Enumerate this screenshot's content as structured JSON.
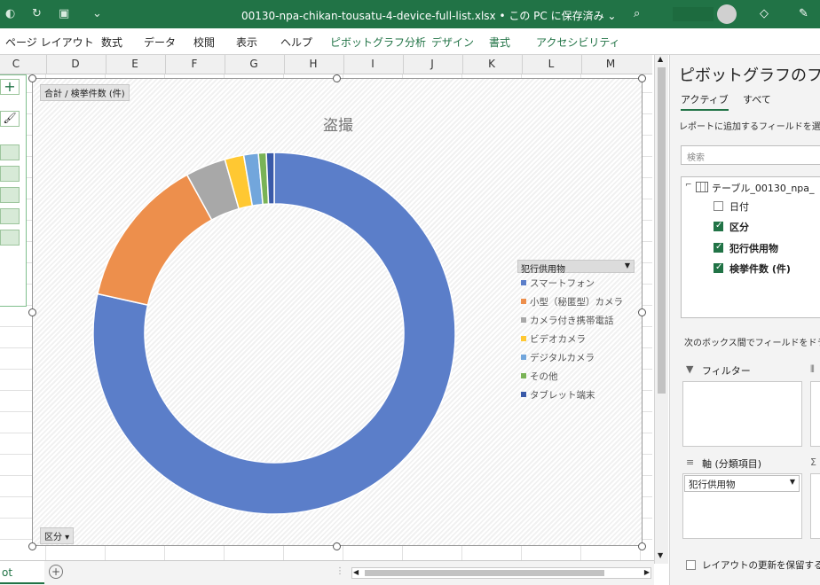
{
  "app": {
    "file_title": "00130-npa-chikan-tousatu-4-device-full-list.xlsx • この PC に保存済み ⌄",
    "accent": "#217346"
  },
  "ribbon": {
    "tabs": [
      "ページ レイアウト",
      "数式",
      "データ",
      "校閲",
      "表示",
      "ヘルプ"
    ],
    "context_tabs": [
      "ピボットグラフ分析",
      "デザイン",
      "書式",
      "アクセシビリティ"
    ]
  },
  "grid": {
    "columns": [
      "C",
      "D",
      "E",
      "F",
      "G",
      "H",
      "I",
      "J",
      "K",
      "L",
      "M"
    ]
  },
  "chart": {
    "value_field_button": "合計 / 検挙件数 (件)",
    "axis_field_button": "区分 ▾"
  },
  "chart_data": {
    "type": "pie",
    "donut": true,
    "title": "盗撮",
    "legend_title": "犯行供用物",
    "legend_position": "right",
    "categories": [
      "スマートフォン",
      "小型（秘匿型）カメラ",
      "カメラ付き携帯電話",
      "ビデオカメラ",
      "デジタルカメラ",
      "その他",
      "タブレット端末"
    ],
    "values": [
      78.5,
      13.5,
      3.6,
      1.7,
      1.3,
      0.7,
      0.7
    ],
    "colors": [
      "#5B7EC9",
      "#ED8F4C",
      "#A8A8A8",
      "#FFC832",
      "#72A6DC",
      "#79B356",
      "#3A5AA8"
    ]
  },
  "sheet": {
    "tab_label": "ot"
  },
  "pane": {
    "title": "ピボットグラフのフィールド",
    "tab_active": "アクティブ",
    "tab_all": "すべて",
    "instruction": "レポートに追加するフィールドを選択",
    "search_placeholder": "検索",
    "table_name": "テーブル_00130_npa_",
    "fields": [
      {
        "label": "日付",
        "checked": false
      },
      {
        "label": "区分",
        "checked": true
      },
      {
        "label": "犯行供用物",
        "checked": true
      },
      {
        "label": "検挙件数 (件)",
        "checked": true
      }
    ],
    "drag_instruction": "次のボックス間でフィールドをドラッグ",
    "filter_label": "フィルター",
    "axis_label": "軸 (分類項目)",
    "axis_value": "犯行供用物",
    "defer_label": "レイアウトの更新を保留する"
  }
}
